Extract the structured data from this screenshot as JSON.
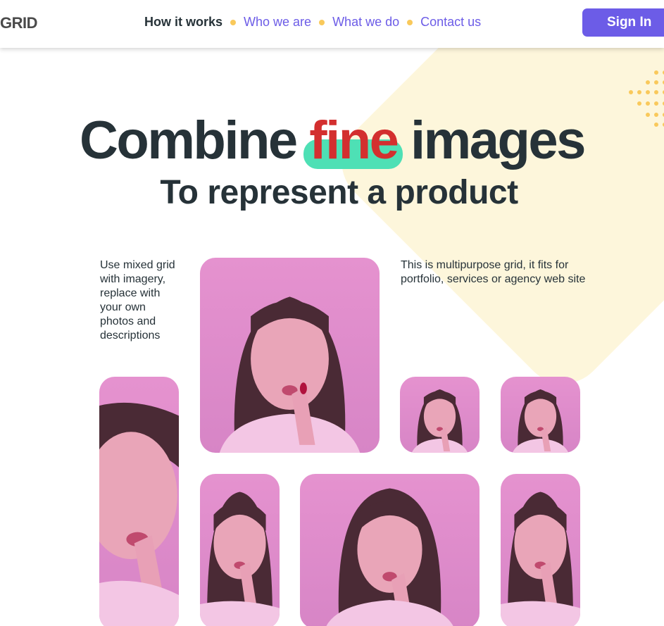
{
  "header": {
    "logo": "GRID",
    "nav": [
      {
        "label": "How it works",
        "active": true
      },
      {
        "label": "Who we are",
        "active": false
      },
      {
        "label": "What we do",
        "active": false
      },
      {
        "label": "Contact us",
        "active": false
      }
    ],
    "signin_label": "Sign In"
  },
  "hero": {
    "title_before": "Combine",
    "title_highlight": "fine",
    "title_after": "images",
    "subtitle": "To represent a product"
  },
  "grid": {
    "left_description": "Use mixed grid with imagery, replace with your own photos and descriptions",
    "right_description": "This is multipurpose grid, it fits for portfolio, services or agency web site"
  },
  "colors": {
    "accent": "#6c5ce7",
    "nav_dot": "#f9c95b",
    "highlight_word": "#d32f2f",
    "highlight_bar": "#4ee0b5",
    "decor_yellow": "#fdf6db",
    "photo_bg": "#e592cf"
  }
}
